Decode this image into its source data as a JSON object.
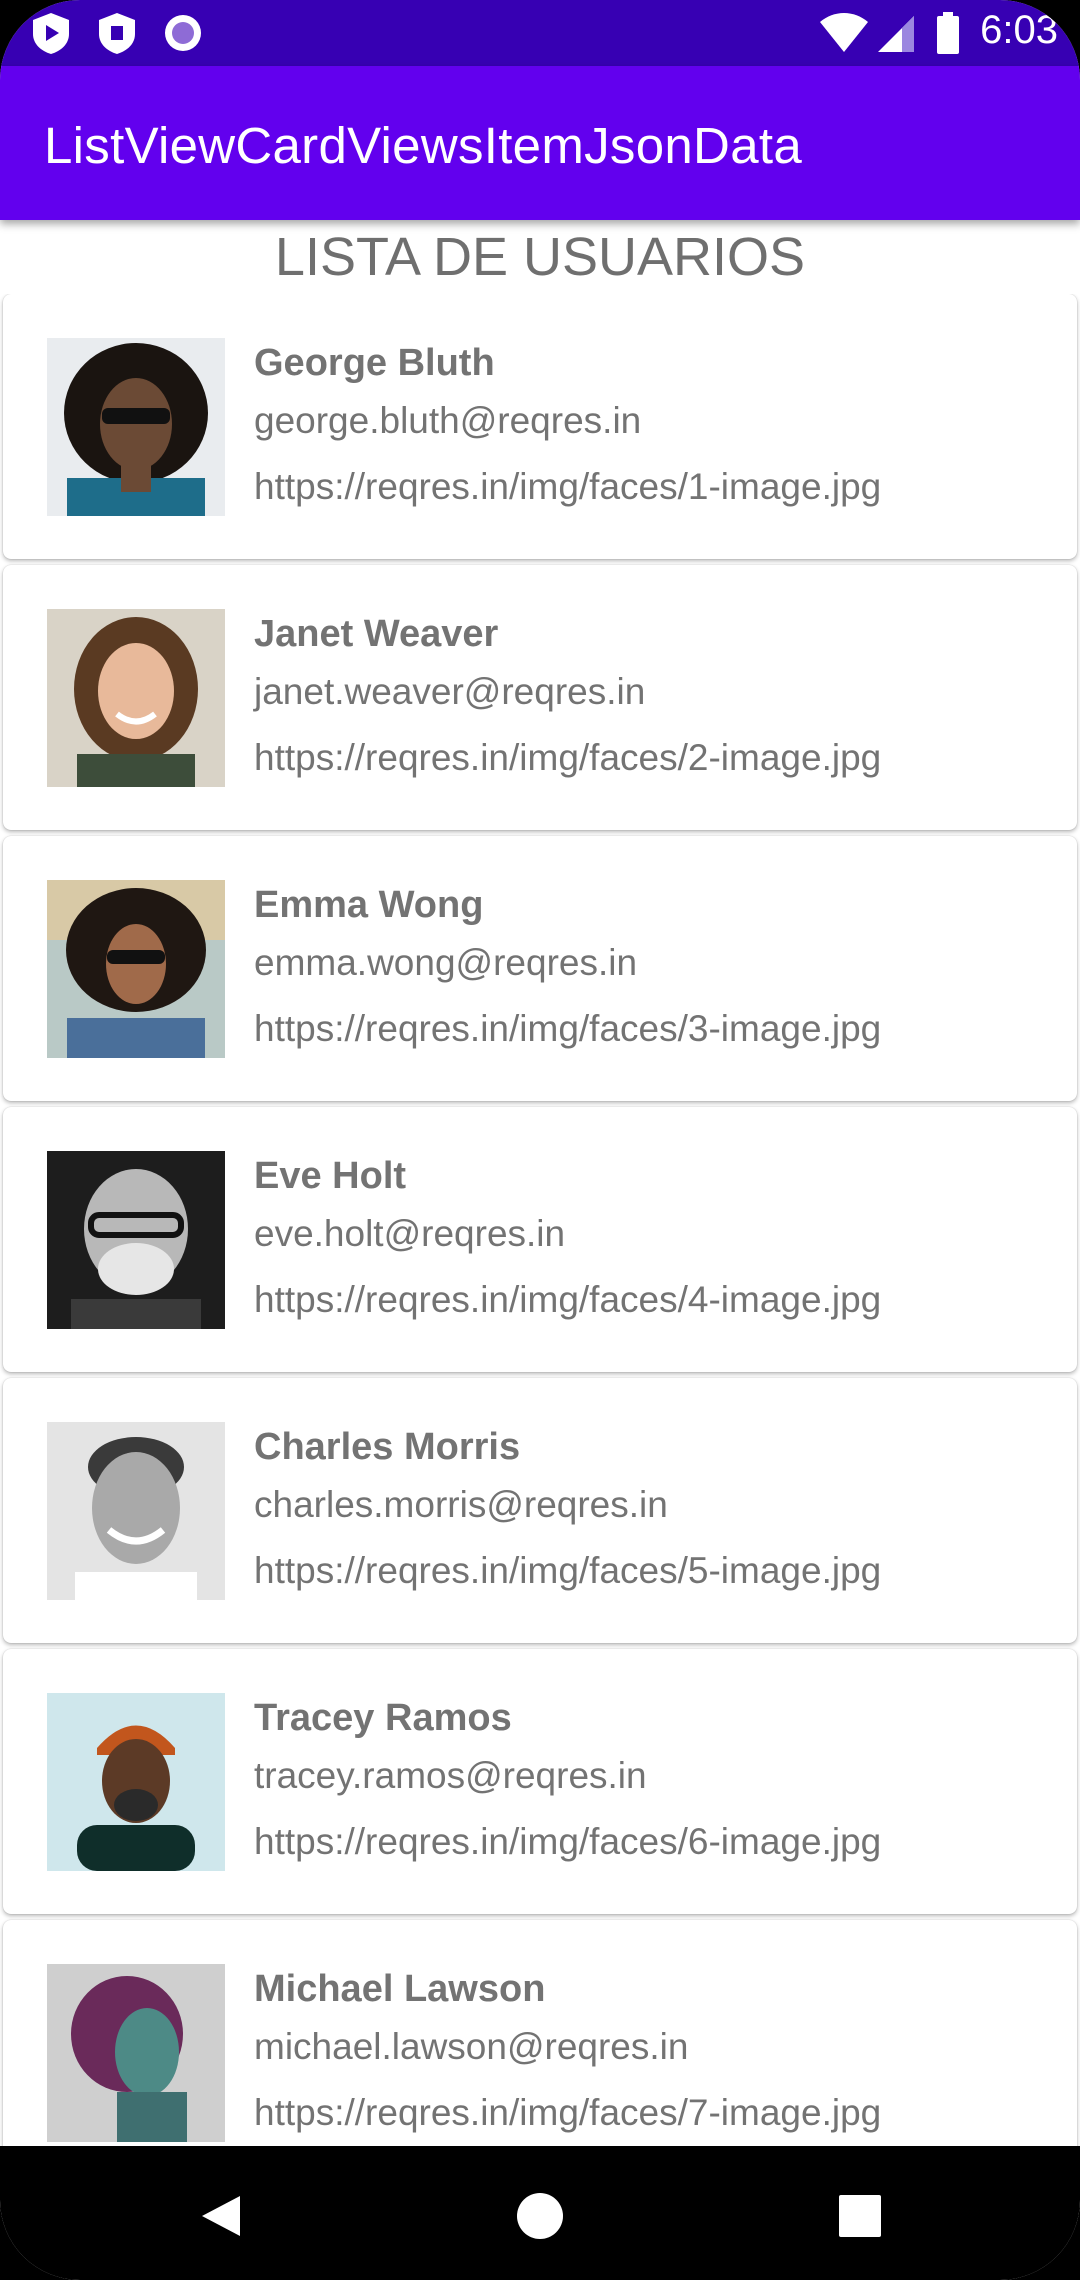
{
  "status_bar": {
    "time": "6:03",
    "left_icons": [
      "media-play-shield-icon",
      "shield-icon",
      "circle-record-icon"
    ],
    "right_icons": [
      "wifi-icon",
      "cell-signal-icon",
      "battery-icon"
    ]
  },
  "app_bar": {
    "title": "ListViewCardViewsItemJsonData",
    "color": "#6200ee",
    "status_color": "#3700b3"
  },
  "list_header": "LISTA DE USUARIOS",
  "users": [
    {
      "name": "George Bluth",
      "email": "george.bluth@reqres.in",
      "url": "https://reqres.in/img/faces/1-image.jpg"
    },
    {
      "name": "Janet Weaver",
      "email": "janet.weaver@reqres.in",
      "url": "https://reqres.in/img/faces/2-image.jpg"
    },
    {
      "name": "Emma Wong",
      "email": "emma.wong@reqres.in",
      "url": "https://reqres.in/img/faces/3-image.jpg"
    },
    {
      "name": "Eve Holt",
      "email": "eve.holt@reqres.in",
      "url": "https://reqres.in/img/faces/4-image.jpg"
    },
    {
      "name": "Charles Morris",
      "email": "charles.morris@reqres.in",
      "url": "https://reqres.in/img/faces/5-image.jpg"
    },
    {
      "name": "Tracey Ramos",
      "email": "tracey.ramos@reqres.in",
      "url": "https://reqres.in/img/faces/6-image.jpg"
    },
    {
      "name": "Michael Lawson",
      "email": "michael.lawson@reqres.in",
      "url": "https://reqres.in/img/faces/7-image.jpg"
    }
  ],
  "nav_bar": {
    "buttons": [
      "back-triangle-icon",
      "home-circle-icon",
      "recents-square-icon"
    ]
  }
}
